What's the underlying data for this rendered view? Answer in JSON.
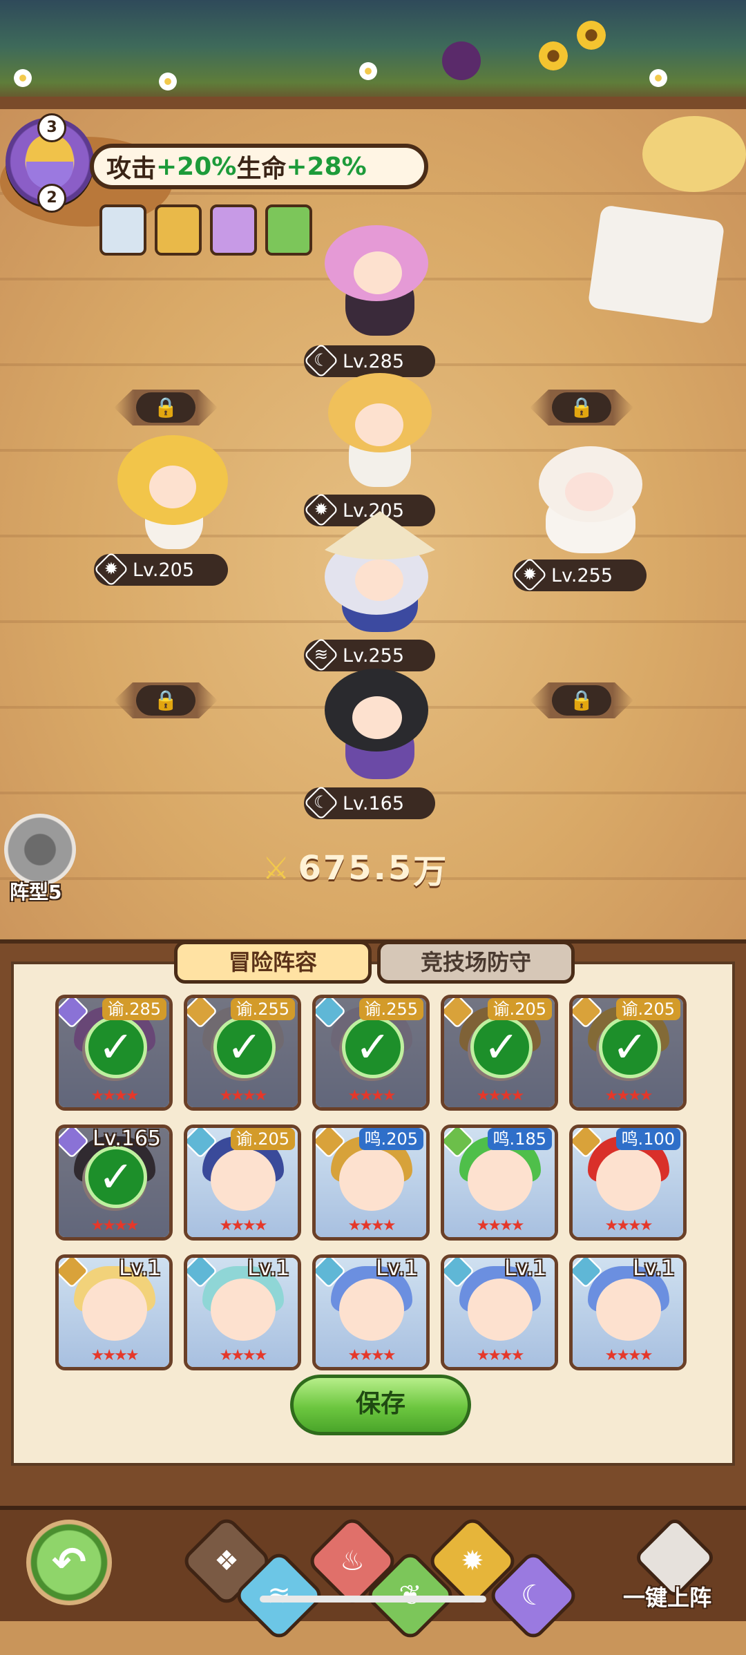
{
  "bonus": {
    "top_count": "3",
    "bottom_count": "2",
    "text_prefix": "攻击",
    "attack": "+20%",
    "mid": "生命",
    "hp": "+28%"
  },
  "synergy_icons": [
    "hero-portrait-icon",
    "hero-portrait-icon",
    "hero-portrait-icon",
    "hero-portrait-icon"
  ],
  "lineup": [
    {
      "slot": "front-center",
      "level": "Lv.285",
      "element": "moon",
      "element_glyph": "☾",
      "color": "#8a72d6"
    },
    {
      "slot": "mid-center",
      "level": "Lv.205",
      "element": "sun",
      "element_glyph": "✹",
      "color": "#d9a23a"
    },
    {
      "slot": "mid-left",
      "level": "Lv.205",
      "element": "sun",
      "element_glyph": "✹",
      "color": "#d9a23a"
    },
    {
      "slot": "mid-right",
      "level": "Lv.255",
      "element": "sun",
      "element_glyph": "✹",
      "color": "#d9a23a"
    },
    {
      "slot": "back-center",
      "level": "Lv.255",
      "element": "wind",
      "element_glyph": "≋",
      "color": "#5fb7d6"
    },
    {
      "slot": "rear-center",
      "level": "Lv.165",
      "element": "moon",
      "element_glyph": "☾",
      "color": "#8a72d6"
    }
  ],
  "formation": {
    "label": "阵型5"
  },
  "power": {
    "value": "675.5",
    "unit": "万"
  },
  "tabs": {
    "adventure": "冒险阵容",
    "arena": "竞技场防守"
  },
  "roster": [
    {
      "level": "谕.285",
      "tag": "gold",
      "selected": true,
      "element": "moon",
      "hair": "#b77ad6"
    },
    {
      "level": "谕.255",
      "tag": "gold",
      "selected": true,
      "element": "sun",
      "hair": "#c8c8c8"
    },
    {
      "level": "谕.255",
      "tag": "gold",
      "selected": true,
      "element": "wind",
      "hair": "#c0c0d8"
    },
    {
      "level": "谕.205",
      "tag": "gold",
      "selected": true,
      "element": "sun",
      "hair": "#e8b64a"
    },
    {
      "level": "谕.205",
      "tag": "gold",
      "selected": true,
      "element": "sun",
      "hair": "#f2c84a"
    },
    {
      "level": "Lv.165",
      "tag": "plain",
      "selected": true,
      "element": "moon",
      "hair": "#3a3a3a"
    },
    {
      "level": "谕.205",
      "tag": "gold",
      "selected": false,
      "element": "wind",
      "hair": "#3a4a9a"
    },
    {
      "level": "鸣.205",
      "tag": "blue",
      "selected": false,
      "element": "sun",
      "hair": "#d7a23a"
    },
    {
      "level": "鸣.185",
      "tag": "blue",
      "selected": false,
      "element": "leaf",
      "hair": "#4fbf4a"
    },
    {
      "level": "鸣.100",
      "tag": "blue",
      "selected": false,
      "element": "sun",
      "hair": "#d9302a"
    },
    {
      "level": "Lv.1",
      "tag": "plain",
      "selected": false,
      "element": "sun",
      "hair": "#f2d27a"
    },
    {
      "level": "Lv.1",
      "tag": "plain",
      "selected": false,
      "element": "wind",
      "hair": "#8fd6d6"
    },
    {
      "level": "Lv.1",
      "tag": "plain",
      "selected": false,
      "element": "wind",
      "hair": "#6b8fe0"
    },
    {
      "level": "Lv.1",
      "tag": "plain",
      "selected": false,
      "element": "wind",
      "hair": "#6b8fe0"
    },
    {
      "level": "Lv.1",
      "tag": "plain",
      "selected": false,
      "element": "wind",
      "hair": "#6b8fe0"
    }
  ],
  "save_label": "保存",
  "filters": [
    {
      "name": "all",
      "glyph": "❖",
      "color": "#7a5a44"
    },
    {
      "name": "wind",
      "glyph": "≋",
      "color": "#6cc6e6"
    },
    {
      "name": "fire",
      "glyph": "♨",
      "color": "#e0706a"
    },
    {
      "name": "leaf",
      "glyph": "❦",
      "color": "#7cc65a"
    },
    {
      "name": "sun",
      "glyph": "✹",
      "color": "#e6b53a"
    },
    {
      "name": "moon",
      "glyph": "☾",
      "color": "#9a7ae0"
    }
  ],
  "auto_deploy_label": "一键上阵",
  "colors": {
    "wood": "#7a4b2a",
    "panel": "#f6ead2",
    "accent_green": "#1d9b3a"
  }
}
